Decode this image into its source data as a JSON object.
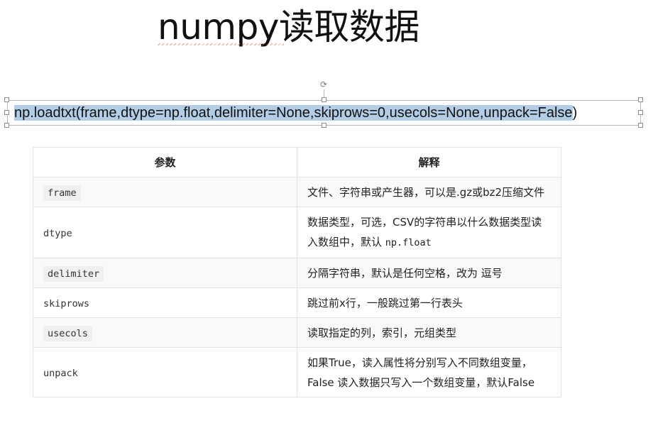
{
  "slide": {
    "title": "numpy读取数据"
  },
  "code_box": {
    "text": "np.loadtxt(frame,dtype=np.float,delimiter=None,skiprows=0,usecols=None,unpack=False",
    "closing": ")"
  },
  "table": {
    "headers": [
      "参数",
      "解释"
    ],
    "rows": [
      {
        "param": "frame",
        "desc": "文件、字符串或产生器，可以是.gz或bz2压缩文件",
        "desc_code": ""
      },
      {
        "param": "dtype",
        "desc": "数据类型，可选，CSV的字符串以什么数据类型读入数组中，默认 ",
        "desc_code": "np.float"
      },
      {
        "param": "delimiter",
        "desc": "分隔字符串，默认是任何空格，改为 逗号",
        "desc_code": ""
      },
      {
        "param": "skiprows",
        "desc": "跳过前x行，一般跳过第一行表头",
        "desc_code": ""
      },
      {
        "param": "usecols",
        "desc": "读取指定的列，索引，元组类型",
        "desc_code": ""
      },
      {
        "param": "unpack",
        "desc": "如果True，读入属性将分别写入不同数组变量，False 读入数据只写入一个数组变量，默认False",
        "desc_code": ""
      }
    ]
  },
  "icons": {
    "rotate": "rotate-handle-icon"
  }
}
